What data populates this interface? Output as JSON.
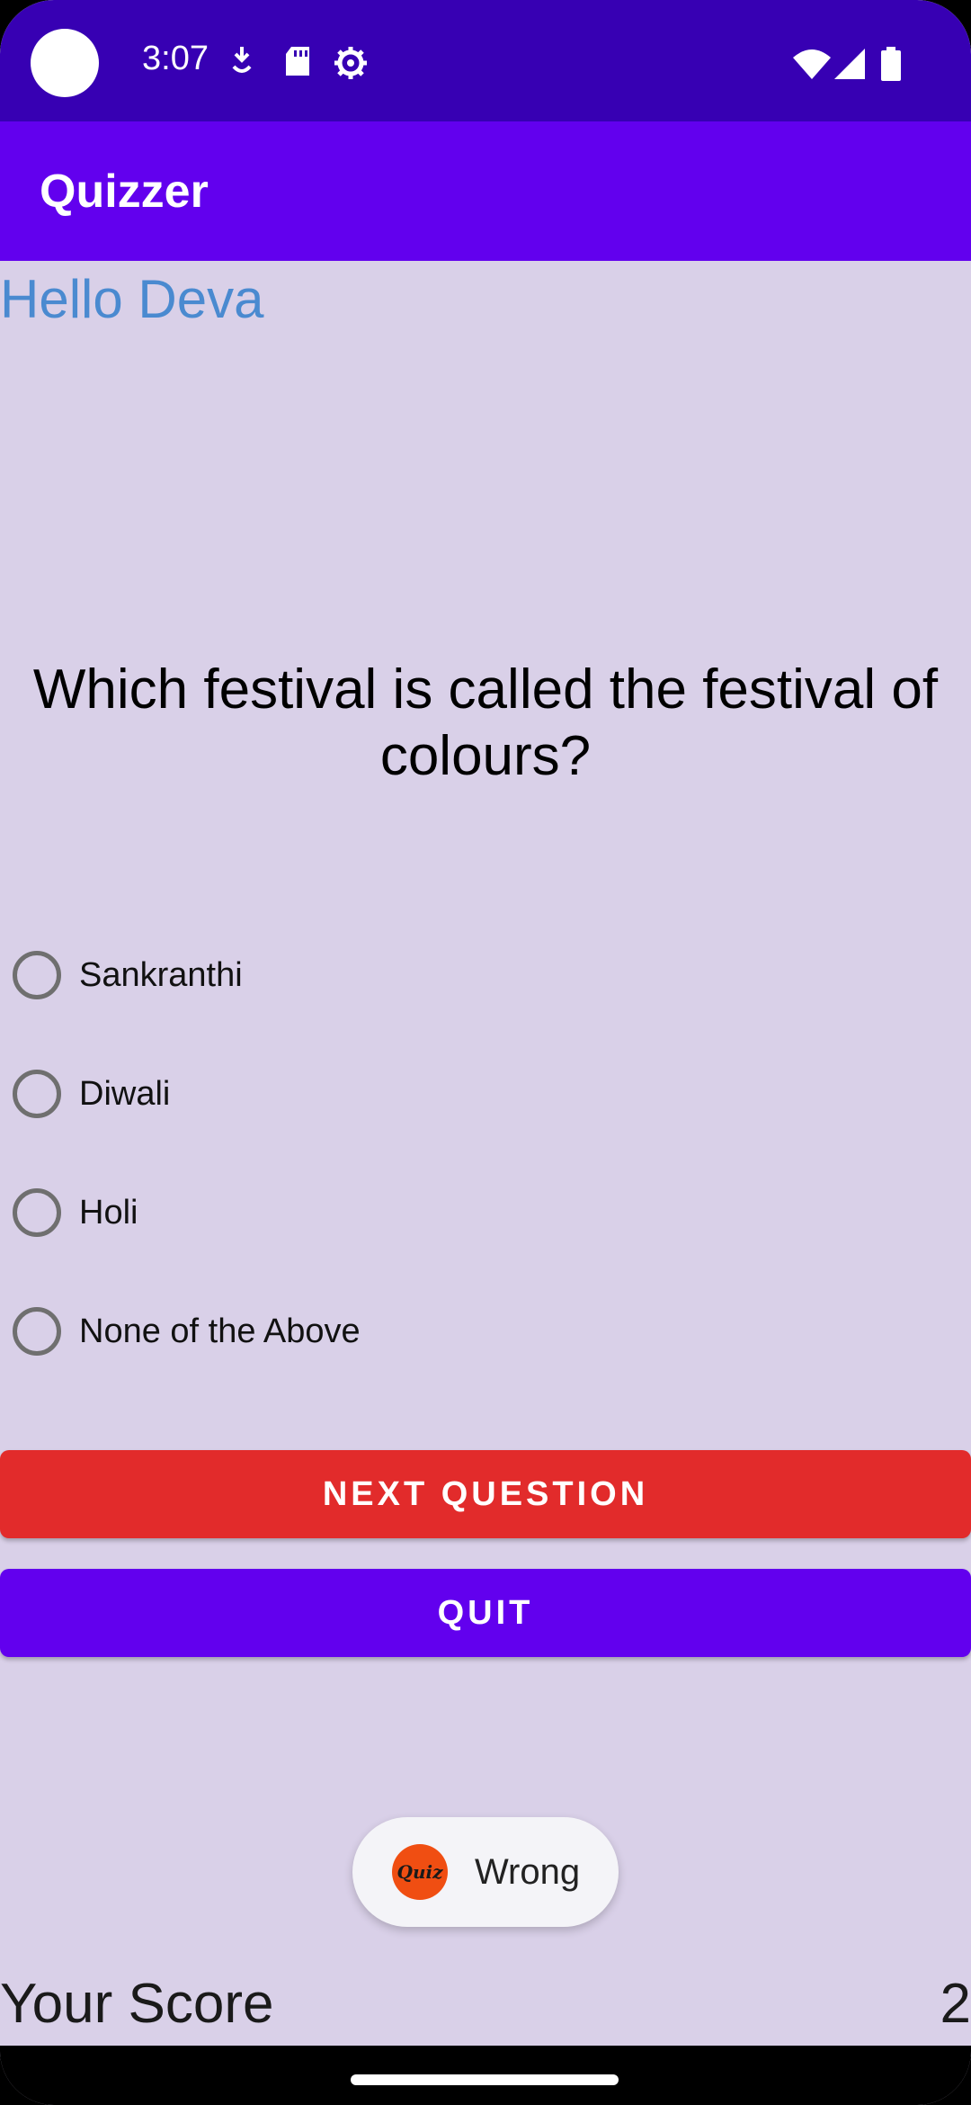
{
  "status_bar": {
    "time": "3:07",
    "icons_left": [
      "download-icon",
      "sd-card-icon",
      "settings-gear-icon"
    ],
    "icons_right": [
      "wifi-icon",
      "cellular-signal-icon",
      "battery-icon"
    ]
  },
  "app_bar": {
    "title": "Quizzer"
  },
  "greeting": "Hello Deva",
  "question": "Which festival is called the festival of colours?",
  "options": [
    {
      "label": "Sankranthi",
      "selected": false
    },
    {
      "label": "Diwali",
      "selected": false
    },
    {
      "label": "Holi",
      "selected": false
    },
    {
      "label": "None of the Above",
      "selected": false
    }
  ],
  "buttons": {
    "next": "NEXT QUESTION",
    "quit": "QUIT"
  },
  "toast": {
    "text": "Wrong",
    "icon": "quiz-logo-icon"
  },
  "score": {
    "label": "Your Score",
    "value": "2"
  },
  "colors": {
    "status_bar": "#3700b3",
    "app_bar": "#6200ee",
    "background": "#d9d0e8",
    "greeting": "#4a8ad0",
    "next_button": "#e22b2b",
    "quit_button": "#6200ee"
  }
}
